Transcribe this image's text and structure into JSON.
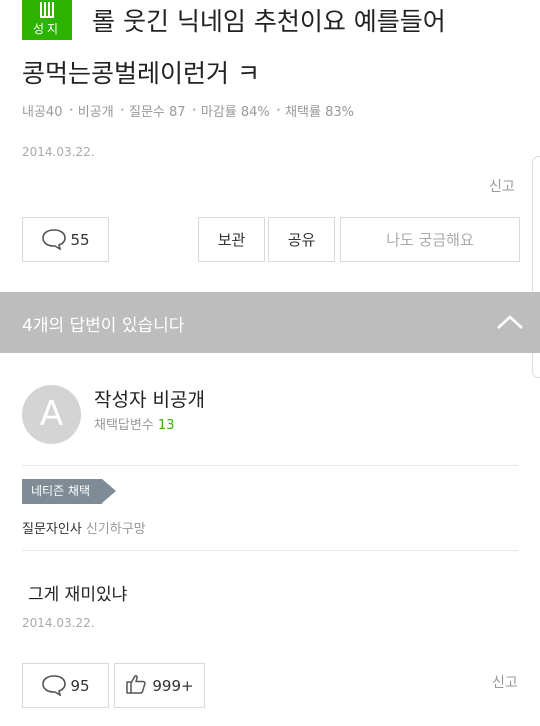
{
  "question": {
    "badge": "성지",
    "title_line1": "롤 웃긴 닉네임 추천이요 예를들어",
    "title_line2": "콩먹는콩벌레이런거 ㅋ",
    "meta": {
      "points": "내공40",
      "visibility": "비공개",
      "question_count": "질문수 87",
      "close_rate": "마감률 84%",
      "adopt_rate": "채택률 83%"
    },
    "date": "2014.03.22.",
    "report": "신고",
    "comments_count": "55",
    "save_label": "보관",
    "share_label": "공유",
    "curious_label": "나도 궁금해요"
  },
  "answers_banner": {
    "text": "4개의 답변이 있습니다"
  },
  "answer": {
    "avatar_letter": "A",
    "writer": "작성자 비공개",
    "adopted_label": "채택답변수",
    "adopted_count": "13",
    "tag": "네티즌 채택",
    "greeting_label": "질문자인사",
    "greeting_text": "신기하구망",
    "body": "그게 재미있냐",
    "date": "2014.03.22.",
    "comments_count": "95",
    "likes_count": "999+",
    "report": "신고"
  },
  "colors": {
    "brand_green": "#2db400",
    "banner_gray": "#bdbdbd",
    "tag_gray": "#7f8c96"
  }
}
